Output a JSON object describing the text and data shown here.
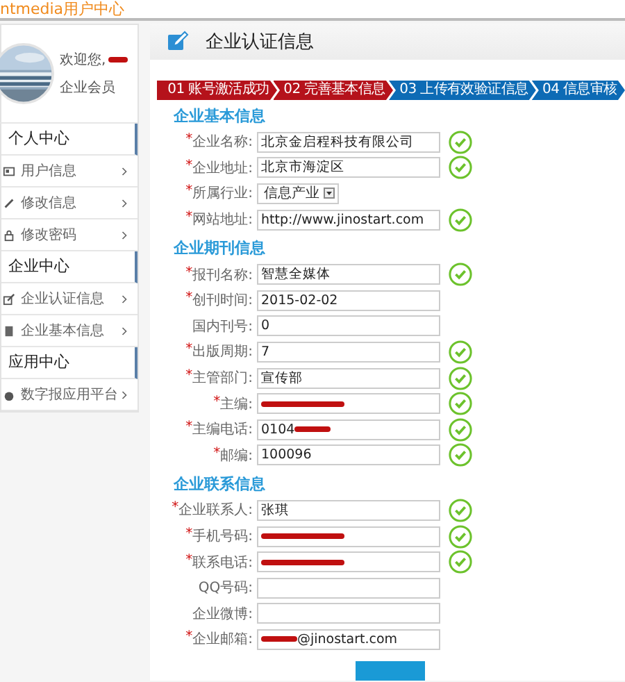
{
  "site_header": {
    "title": "ntmedia用户中心"
  },
  "profile": {
    "greeting": "欢迎您,",
    "name_redacted": true,
    "role": "企业会员"
  },
  "sidebar": [
    {
      "title": "个人中心",
      "items": [
        {
          "label": "用户信息",
          "kind": "card"
        },
        {
          "label": "修改信息",
          "kind": "pencil"
        },
        {
          "label": "修改密码",
          "kind": "lock"
        }
      ]
    },
    {
      "title": "企业中心",
      "items": [
        {
          "label": "企业认证信息",
          "kind": "edit"
        },
        {
          "label": "企业基本信息",
          "kind": "doc"
        }
      ]
    },
    {
      "title": "应用中心",
      "items": [
        {
          "label": "数字报应用平台",
          "kind": "blob"
        }
      ]
    }
  ],
  "page_title": "企业认证信息",
  "steps": [
    {
      "label": "01 账号激活成功",
      "done": true
    },
    {
      "label": "02 完善基本信息",
      "done": true
    },
    {
      "label": "03 上传有效验证信息",
      "done": false
    },
    {
      "label": "04 信息审核",
      "done": false
    }
  ],
  "sections": [
    {
      "title": "企业基本信息",
      "fields": [
        {
          "marker": "*",
          "label": "企业名称:",
          "kind": "text",
          "value": "北京金启程科技有限公司",
          "valid": true
        },
        {
          "marker": "*",
          "label": "企业地址:",
          "kind": "text",
          "value": "北京市海淀区",
          "valid": true
        },
        {
          "marker": "*",
          "label": "所属行业:",
          "kind": "select",
          "value": "信息产业",
          "valid": false
        },
        {
          "marker": "*",
          "label": "网站地址:",
          "kind": "text",
          "value": "http://www.jinostart.com",
          "valid": true
        }
      ]
    },
    {
      "title": "企业期刊信息",
      "fields": [
        {
          "marker": "*",
          "label": "报刊名称:",
          "kind": "text",
          "value": "智慧全媒体",
          "valid": true
        },
        {
          "marker": "*",
          "label": "创刊时间:",
          "kind": "text",
          "value": "2015-02-02",
          "valid": false
        },
        {
          "label": "国内刊号:",
          "kind": "text",
          "value": "0",
          "valid": false
        },
        {
          "marker": "*",
          "label": "出版周期:",
          "kind": "text",
          "value": "7",
          "valid": true
        },
        {
          "marker": "*",
          "label": "主管部门:",
          "kind": "text",
          "value": "宣传部",
          "valid": true
        },
        {
          "marker": "*",
          "label": "主编:",
          "kind": "text",
          "redacted": true,
          "valid": true
        },
        {
          "marker": "*",
          "label": "主编电话:",
          "kind": "text",
          "text_before": "0104",
          "redacted": true,
          "valid": true
        },
        {
          "marker": "*",
          "label": "邮编:",
          "kind": "text",
          "value": "100096",
          "valid": true
        }
      ]
    },
    {
      "title": "企业联系信息",
      "fields": [
        {
          "marker": "*",
          "label": "企业联系人:",
          "kind": "text",
          "value": "张琪",
          "valid": true
        },
        {
          "marker": "*",
          "label": "手机号码:",
          "kind": "text",
          "redacted": true,
          "valid": true
        },
        {
          "marker": "*",
          "label": "联系电话:",
          "kind": "text",
          "redacted": true,
          "valid": true
        },
        {
          "label": "QQ号码:",
          "kind": "text",
          "valid": false
        },
        {
          "label": "企业微博:",
          "kind": "text",
          "valid": false
        },
        {
          "marker": "*",
          "label": "企业邮箱:",
          "kind": "text",
          "text_after": "@jinostart.com",
          "redacted": true,
          "valid": false
        }
      ]
    }
  ]
}
